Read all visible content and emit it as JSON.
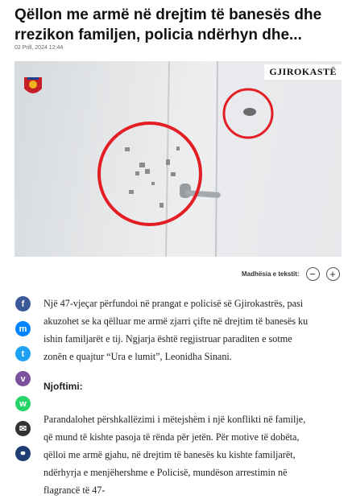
{
  "article": {
    "title": "Qëllon me armë në drejtim të banesës dhe rrezikon familjen, policia ndërhyn dhe...",
    "date": "02 Prill, 2024 12:44",
    "image_watermark": "GJIROKASTË",
    "paragraph1": "Një 47-vjeçar përfundoi në prangat e policisë së Gjirokastrës, pasi akuzohet se ka qëlluar me armë zjarri çifte në drejtim të banesës ku ishin familjarët e tij. Ngjarja është regjistruar paraditen e sotme zonën e quajtur “Ura e lumit”, Leonidha Sinani.",
    "subheading": "Njoftimi:",
    "paragraph2": "Parandalohet përshkallëzimi i mëtejshëm i një konflikti në familje, që mund të kishte pasoja të rënda për jetën. Për motive të dobëta, qëlloi me armë gjahu, në drejtim të banesës ku kishte familjarët, ndërhyrja e menjëhershme e Policisë, mundëson arrestimin në flagrancë të 47-"
  },
  "font_size_control": {
    "label": "Madhësia e tekstit:",
    "decrease": "−",
    "increase": "+"
  },
  "share_buttons": [
    {
      "icon": "facebook-icon",
      "glyph": "f",
      "color": "#3b5998"
    },
    {
      "icon": "messenger-icon",
      "glyph": "m",
      "color": "#0084ff"
    },
    {
      "icon": "twitter-icon",
      "glyph": "t",
      "color": "#1da1f2"
    },
    {
      "icon": "viber-icon",
      "glyph": "v",
      "color": "#7b519d"
    },
    {
      "icon": "whatsapp-icon",
      "glyph": "w",
      "color": "#25d366"
    },
    {
      "icon": "email-icon",
      "glyph": "✉",
      "color": "#333333"
    },
    {
      "icon": "link-icon",
      "glyph": "⚭",
      "color": "#1e3d73"
    }
  ]
}
